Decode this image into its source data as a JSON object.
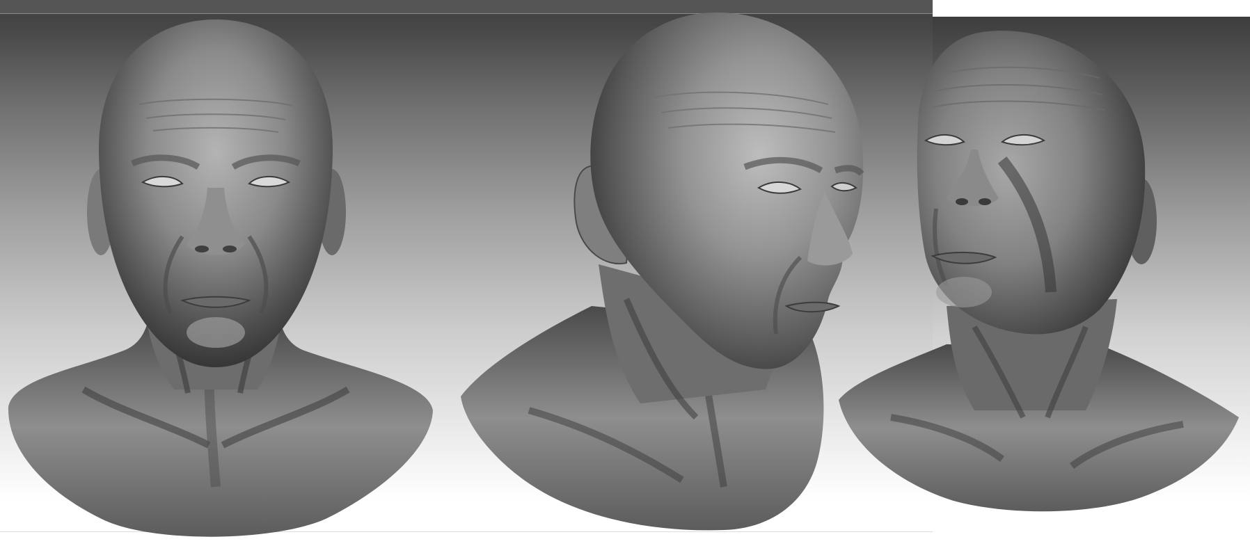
{
  "scene": {
    "background_top": "#3f3f3f",
    "background_bottom": "#ffffff",
    "mesh_color": "#9a9a9a"
  },
  "views": [
    {
      "id": "front",
      "label": ""
    },
    {
      "id": "three-quarter",
      "label": ""
    },
    {
      "id": "upturned",
      "label": ""
    }
  ]
}
